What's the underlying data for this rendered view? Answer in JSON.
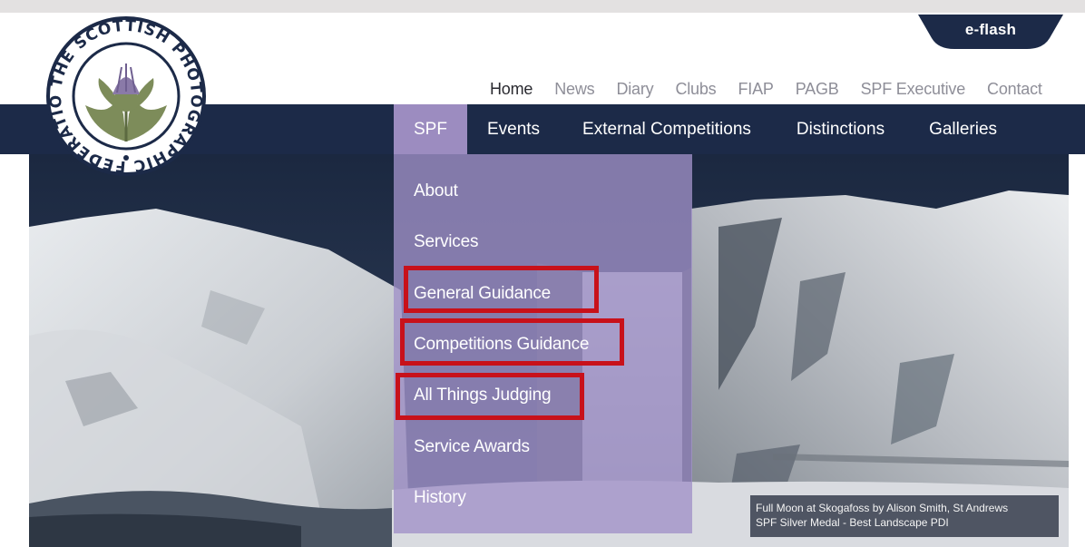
{
  "header": {
    "eflash_label": "e-flash",
    "logo_text": "THE SCOTTISH PHOTOGRAPHIC FEDERATION"
  },
  "top_nav": [
    {
      "label": "Home",
      "active": true
    },
    {
      "label": "News"
    },
    {
      "label": "Diary"
    },
    {
      "label": "Clubs"
    },
    {
      "label": "FIAP"
    },
    {
      "label": "PAGB"
    },
    {
      "label": "SPF Executive"
    },
    {
      "label": "Contact"
    }
  ],
  "main_nav": [
    {
      "label": "SPF",
      "active": true
    },
    {
      "label": "Events"
    },
    {
      "label": "External Competitions"
    },
    {
      "label": "Distinctions"
    },
    {
      "label": "Galleries"
    }
  ],
  "dropdown": {
    "items": [
      {
        "label": "About"
      },
      {
        "label": "Services"
      },
      {
        "label": "General Guidance",
        "highlighted": true
      },
      {
        "label": "Competitions Guidance",
        "highlighted": true
      },
      {
        "label": "All Things Judging",
        "highlighted": true
      },
      {
        "label": "Service Awards"
      },
      {
        "label": "History"
      }
    ]
  },
  "caption": {
    "line1": "Full Moon at Skogafoss by Alison Smith, St Andrews",
    "line2": "SPF Silver Medal - Best Landscape PDI"
  },
  "colors": {
    "navy": "#1c2a48",
    "menu_purple": "#9c8cc0",
    "highlight_red": "#c8111a",
    "logo_green": "#7d8c5a",
    "logo_purple": "#8a7aa8"
  }
}
